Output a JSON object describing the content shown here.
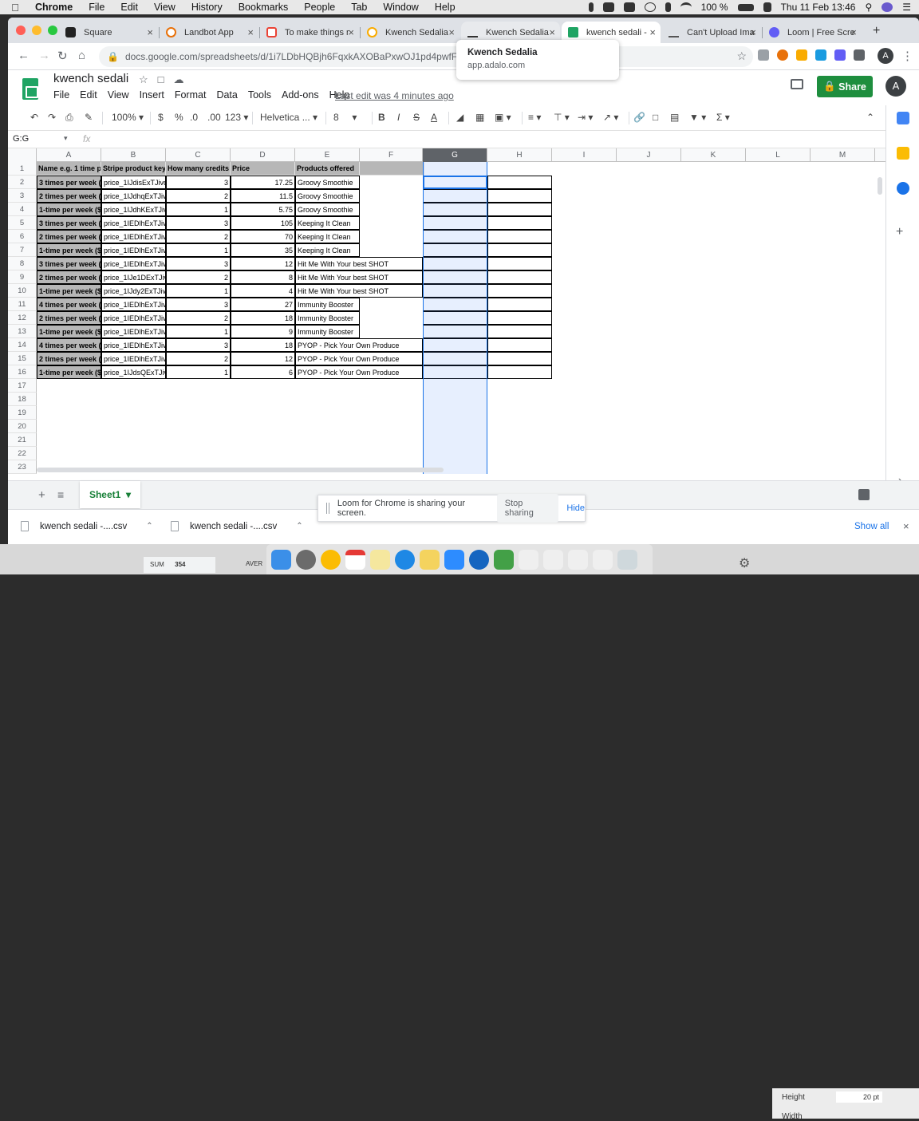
{
  "mac_menu": {
    "app": "Chrome",
    "items": [
      "File",
      "Edit",
      "View",
      "History",
      "Bookmarks",
      "People",
      "Tab",
      "Window",
      "Help"
    ],
    "battery": "100 %",
    "datetime": "Thu 11 Feb  13:46"
  },
  "tabs": [
    {
      "title": "Square",
      "color": "#222"
    },
    {
      "title": "Landbot App",
      "color": "#e8710a"
    },
    {
      "title": "To make things r",
      "color": "#ea4335"
    },
    {
      "title": "Kwench Sedalia",
      "color": "#1a73e8"
    },
    {
      "title": "Kwench Sedalia",
      "color": "#333"
    },
    {
      "title": "kwench sedali -",
      "color": "#1fa463"
    },
    {
      "title": "Can't Upload Ima",
      "color": "#555"
    },
    {
      "title": "Loom | Free Scre",
      "color": "#625df5"
    }
  ],
  "tab_tooltip": {
    "title": "Kwench Sedalia",
    "url": "app.adalo.com"
  },
  "omnibox": {
    "url": "docs.google.com/spreadsheets/d/1i7LDbHQBjh6FqxkAXOBaPxwOJ1pd4pwfFa-CE"
  },
  "profile_initial": "A",
  "doc": {
    "title": "kwench sedali",
    "menus": [
      "File",
      "Edit",
      "View",
      "Insert",
      "Format",
      "Data",
      "Tools",
      "Add-ons",
      "Help"
    ],
    "last_edit": "Last edit was 4 minutes ago",
    "share": "Share",
    "avatar": "A"
  },
  "toolbar": {
    "zoom": "100%",
    "currency": "$",
    "percent": "%",
    "dec_less": ".0",
    "dec_more": ".00",
    "format": "123",
    "font": "Helvetica ...",
    "size": "8"
  },
  "namebox": "G:G",
  "fx": "fx",
  "columns": [
    "A",
    "B",
    "C",
    "D",
    "E",
    "F",
    "G",
    "H",
    "I",
    "J",
    "K",
    "L",
    "M"
  ],
  "rows": [
    [
      "Name e.g. 1 time pe",
      "Stripe product key",
      "How many credits c",
      "Price",
      "Products offered"
    ],
    [
      "3 times per week ($",
      "price_1IJdisExTJivdl",
      "3",
      "17.25",
      "Groovy Smoothie"
    ],
    [
      "2 times per week ($",
      "price_1IJdhqExTJivd",
      "2",
      "11.5",
      "Groovy Smoothie"
    ],
    [
      "1-time per week ($",
      "price_1IJdhKExTJivd",
      "1",
      "5.75",
      "Groovy Smoothie"
    ],
    [
      "3 times per week ($",
      "price_1IEDlhExTJivd",
      "3",
      "105",
      "Keeping It Clean"
    ],
    [
      "2 times per week ($",
      "price_1IEDlhExTJivd",
      "2",
      "70",
      "Keeping It Clean"
    ],
    [
      "1-time per week ($3",
      "price_1IEDlhExTJivd",
      "1",
      "35",
      "Keeping It Clean"
    ],
    [
      "3 times per week ($",
      "price_1IEDlhExTJivd",
      "3",
      "12",
      "Hit Me With Your best SHOT"
    ],
    [
      "2 times per week ($",
      "price_1IJe1DExTJivd",
      "2",
      "8",
      "Hit Me With Your best SHOT"
    ],
    [
      "1-time per week ($4",
      "price_1IJdy2ExTJivd",
      "1",
      "4",
      "Hit Me With Your best SHOT"
    ],
    [
      "4 times per week ($",
      "price_1IEDlhExTJivd",
      "3",
      "27",
      "Immunity Booster"
    ],
    [
      "2 times per week ($",
      "price_1IEDlhExTJivd",
      "2",
      "18",
      "Immunity Booster"
    ],
    [
      "1-time per week ($9",
      "price_1IEDlhExTJivd",
      "1",
      "9",
      "Immunity Booster"
    ],
    [
      "4 times per week ($",
      "price_1IEDlhExTJivd",
      "3",
      "18",
      "PYOP - Pick Your Own Produce"
    ],
    [
      "2 times per week ($",
      "price_1IEDlhExTJivd",
      "2",
      "12",
      "PYOP - Pick Your Own Produce"
    ],
    [
      "1-time per week ($6",
      "price_1IJdsQExTJivd",
      "1",
      "6",
      "PYOP - Pick Your Own Produce"
    ]
  ],
  "row_numbers": [
    "1",
    "2",
    "3",
    "4",
    "5",
    "6",
    "7",
    "8",
    "9",
    "10",
    "11",
    "12",
    "13",
    "14",
    "15",
    "16",
    "17",
    "18",
    "19",
    "20",
    "21",
    "22",
    "23"
  ],
  "sheet_tab": "Sheet1",
  "downloads": [
    "kwench sedali -....csv",
    "kwench sedali -....csv"
  ],
  "loom": {
    "message": "Loom for Chrome is sharing your screen.",
    "stop": "Stop sharing",
    "hide": "Hide"
  },
  "show_all": "Show all",
  "status": {
    "sum_label": "SUM",
    "sum_value": "354",
    "avg_label": "AVER"
  },
  "inspector": {
    "height_label": "Height",
    "height_value": "20 pt",
    "width_label": "Width"
  }
}
